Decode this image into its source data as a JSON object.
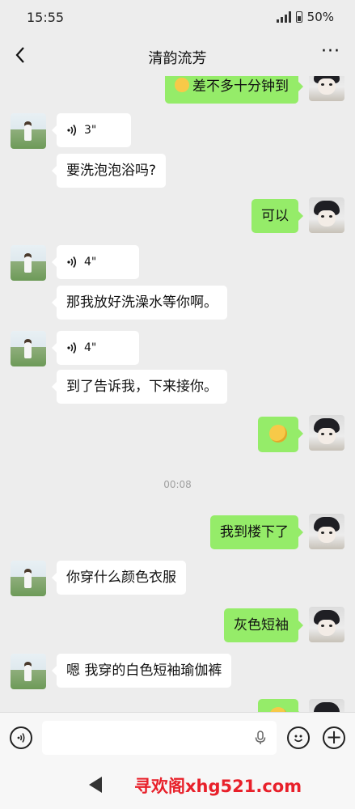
{
  "status": {
    "time": "15:55",
    "battery": "50%"
  },
  "header": {
    "title": "清韵流芳"
  },
  "messages": [
    {
      "id": 0,
      "side": "right",
      "type": "text",
      "text": "差不多十分钟到",
      "emoji": "ok-hand"
    },
    {
      "id": 1,
      "side": "left",
      "type": "voice",
      "duration": "3\""
    },
    {
      "id": 2,
      "side": "left",
      "type": "text",
      "text": "要洗泡泡浴吗?"
    },
    {
      "id": 3,
      "side": "right",
      "type": "text",
      "text": "可以"
    },
    {
      "id": 4,
      "side": "left",
      "type": "voice",
      "duration": "4\""
    },
    {
      "id": 5,
      "side": "left",
      "type": "text",
      "text": "那我放好洗澡水等你啊。"
    },
    {
      "id": 6,
      "side": "left",
      "type": "voice",
      "duration": "4\""
    },
    {
      "id": 7,
      "side": "left",
      "type": "text",
      "text": "到了告诉我，下来接你。"
    },
    {
      "id": 8,
      "side": "right",
      "type": "emoji",
      "emoji": "ok-hand"
    },
    {
      "id": 9,
      "side": "right",
      "type": "text",
      "text": "我到楼下了"
    },
    {
      "id": 10,
      "side": "left",
      "type": "text",
      "text": "你穿什么颜色衣服"
    },
    {
      "id": 11,
      "side": "right",
      "type": "text",
      "text": "灰色短袖"
    },
    {
      "id": 12,
      "side": "left",
      "type": "text",
      "text": "嗯 我穿的白色短袖瑜伽裤"
    }
  ],
  "timestamp": "00:08",
  "watermark": "寻欢阁xhg521.com",
  "colors": {
    "background": "#ededed",
    "green_bubble": "#95ec69",
    "white_bubble": "#ffffff",
    "watermark": "#e8202a"
  }
}
